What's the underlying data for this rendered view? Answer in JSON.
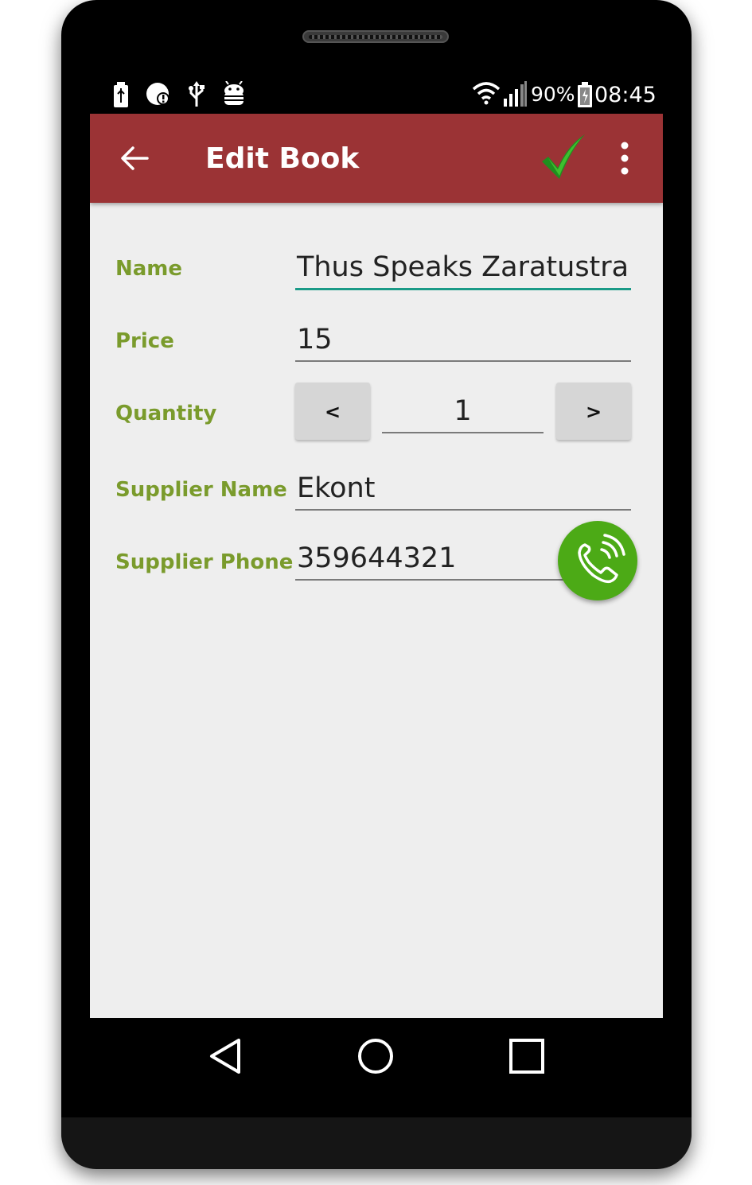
{
  "status_bar": {
    "battery_percent": "90%",
    "time": "08:45",
    "icons": [
      "battery-charging-icon",
      "notification-icon",
      "usb-icon",
      "android-debug-icon",
      "wifi-icon",
      "signal-icon",
      "battery-icon"
    ]
  },
  "app_bar": {
    "title": "Edit Book",
    "back_icon": "arrow-back-icon",
    "save_icon": "checkmark-icon",
    "menu_icon": "more-vert-icon"
  },
  "form": {
    "name": {
      "label": "Name",
      "value": "Thus Speaks Zaratustra"
    },
    "price": {
      "label": "Price",
      "value": "15"
    },
    "quantity": {
      "label": "Quantity",
      "decrement_label": "<",
      "value": "1",
      "increment_label": ">"
    },
    "supplier_name": {
      "label": "Supplier Name",
      "value": "Ekont"
    },
    "supplier_phone": {
      "label": "Supplier Phone",
      "value": "359644321",
      "call_icon": "phone-call-icon"
    }
  },
  "nav_bar": {
    "items": [
      "back-triangle-icon",
      "home-circle-icon",
      "recents-square-icon"
    ]
  },
  "colors": {
    "app_bar": "#9b3335",
    "label": "#7a9b2c",
    "active_underline": "#1a9a87",
    "call_button": "#4caa16",
    "background": "#eeeeee"
  }
}
